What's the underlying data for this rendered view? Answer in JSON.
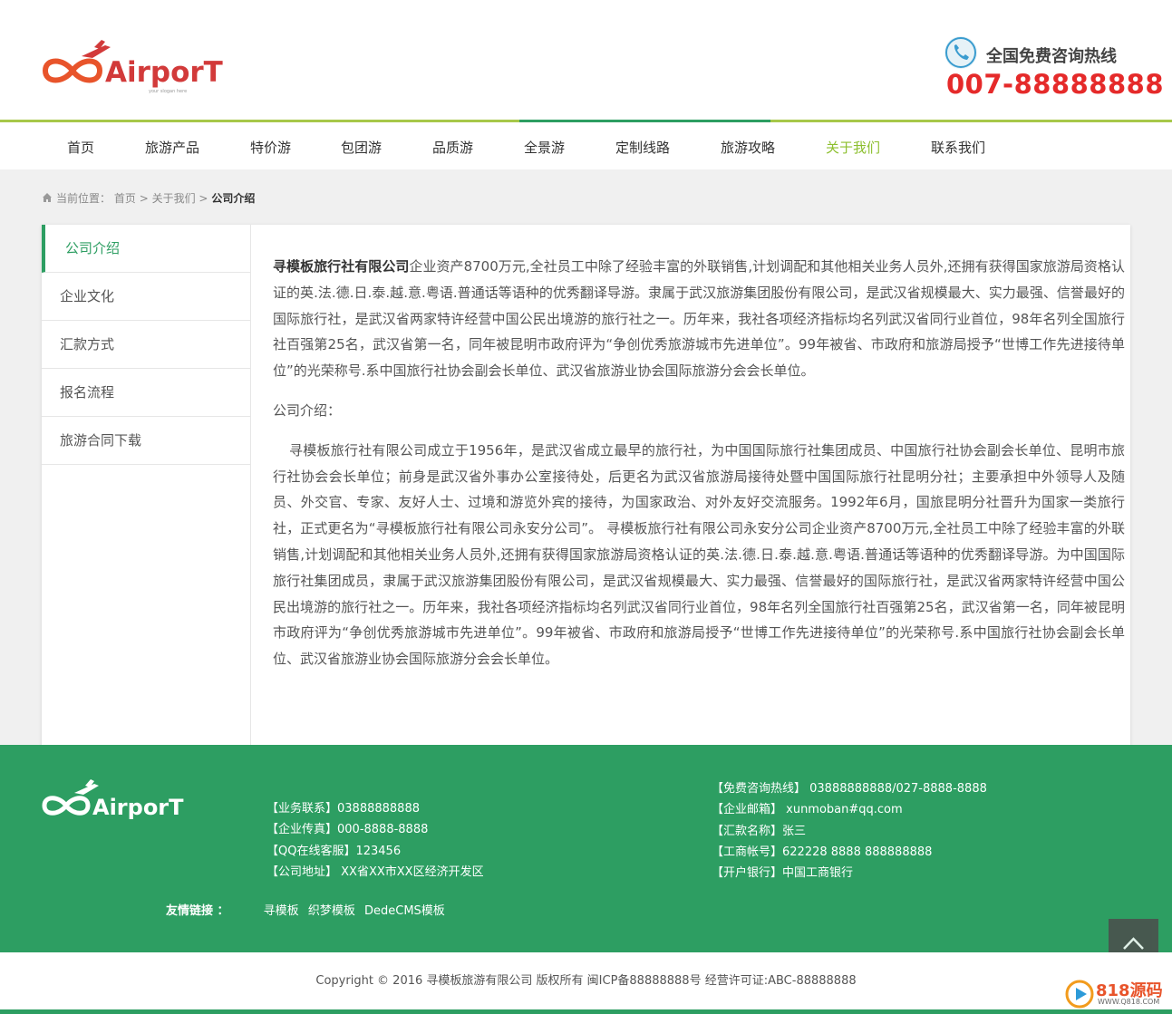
{
  "header": {
    "logo_text": "AirporT",
    "logo_sub": "your slogan here",
    "hotline_label": "全国免费咨询热线",
    "hotline_number": "007-88888888"
  },
  "nav": {
    "items": [
      {
        "label": "首页"
      },
      {
        "label": "旅游产品"
      },
      {
        "label": "特价游"
      },
      {
        "label": "包团游"
      },
      {
        "label": "品质游"
      },
      {
        "label": "全景游"
      },
      {
        "label": "定制线路"
      },
      {
        "label": "旅游攻略"
      },
      {
        "label": "关于我们",
        "active": true
      },
      {
        "label": "联系我们"
      }
    ]
  },
  "breadcrumb": {
    "prefix": "当前位置：",
    "home": "首页",
    "sep": ">",
    "parent": "关于我们",
    "current": "公司介绍"
  },
  "sidebar": {
    "items": [
      {
        "label": "公司介绍",
        "active": true
      },
      {
        "label": "企业文化"
      },
      {
        "label": "汇款方式"
      },
      {
        "label": "报名流程"
      },
      {
        "label": "旅游合同下载"
      }
    ]
  },
  "content": {
    "lead_name": "寻模板旅行社有限公司",
    "lead_rest": "企业资产8700万元,全社员工中除了经验丰富的外联销售,计划调配和其他相关业务人员外,还拥有获得国家旅游局资格认证的英.法.德.日.泰.越.意.粤语.普通话等语种的优秀翻译导游。隶属于武汉旅游集团股份有限公司，是武汉省规模最大、实力最强、信誉最好的国际旅行社，是武汉省两家特许经营中国公民出境游的旅行社之一。历年来，我社各项经济指标均名列武汉省同行业首位，98年名列全国旅行社百强第25名，武汉省第一名，同年被昆明市政府评为“争创优秀旅游城市先进单位”。99年被省、市政府和旅游局授予“世博工作先进接待单位”的光荣称号.系中国旅行社协会副会长单位、武汉省旅游业协会国际旅游分会会长单位。",
    "section_title": "公司介绍：",
    "body": "寻模板旅行社有限公司成立于1956年，是武汉省成立最早的旅行社，为中国国际旅行社集团成员、中国旅行社协会副会长单位、昆明市旅行社协会会长单位；前身是武汉省外事办公室接待处，后更名为武汉省旅游局接待处暨中国国际旅行社昆明分社；主要承担中外领导人及随员、外交官、专家、友好人士、过境和游览外宾的接待，为国家政治、对外友好交流服务。1992年6月，国旅昆明分社晋升为国家一类旅行社，正式更名为“寻模板旅行社有限公司永安分公司”。 寻模板旅行社有限公司永安分公司企业资产8700万元,全社员工中除了经验丰富的外联销售,计划调配和其他相关业务人员外,还拥有获得国家旅游局资格认证的英.法.德.日.泰.越.意.粤语.普通话等语种的优秀翻译导游。为中国国际旅行社集团成员，隶属于武汉旅游集团股份有限公司，是武汉省规模最大、实力最强、信誉最好的国际旅行社，是武汉省两家特许经营中国公民出境游的旅行社之一。历年来，我社各项经济指标均名列武汉省同行业首位，98年名列全国旅行社百强第25名，武汉省第一名，同年被昆明市政府评为“争创优秀旅游城市先进单位”。99年被省、市政府和旅游局授予“世博工作先进接待单位”的光荣称号.系中国旅行社协会副会长单位、武汉省旅游业协会国际旅游分会会长单位。"
  },
  "footer": {
    "logo_text": "AirporT",
    "col1": [
      "【业务联系】03888888888",
      "【企业传真】000-8888-8888",
      "【QQ在线客服】123456",
      "【公司地址】 XX省XX市XX区经济开发区"
    ],
    "col2": [
      "【免费咨询热线】 03888888888/027-8888-8888",
      "【企业邮箱】  xunmoban#qq.com",
      "【汇款名称】张三",
      "【工商帐号】622228 8888 888888888",
      "【开户银行】中国工商银行"
    ],
    "links_label": "友情链接 ：",
    "links": [
      "寻模板",
      "织梦模板",
      "DedeCMS模板"
    ],
    "copyright": "Copyright © 2016    寻模板旅游有限公司    版权所有 闽ICP备88888888号    经营许可证:ABC-88888888"
  },
  "watermark": {
    "text": "818源码",
    "sub": "WWW.Q818.COM"
  },
  "colors": {
    "brand_green": "#2d9e62",
    "nav_active": "#8cbf2e",
    "hotline_red": "#e52a2a",
    "logo_red": "#d23a3a"
  }
}
